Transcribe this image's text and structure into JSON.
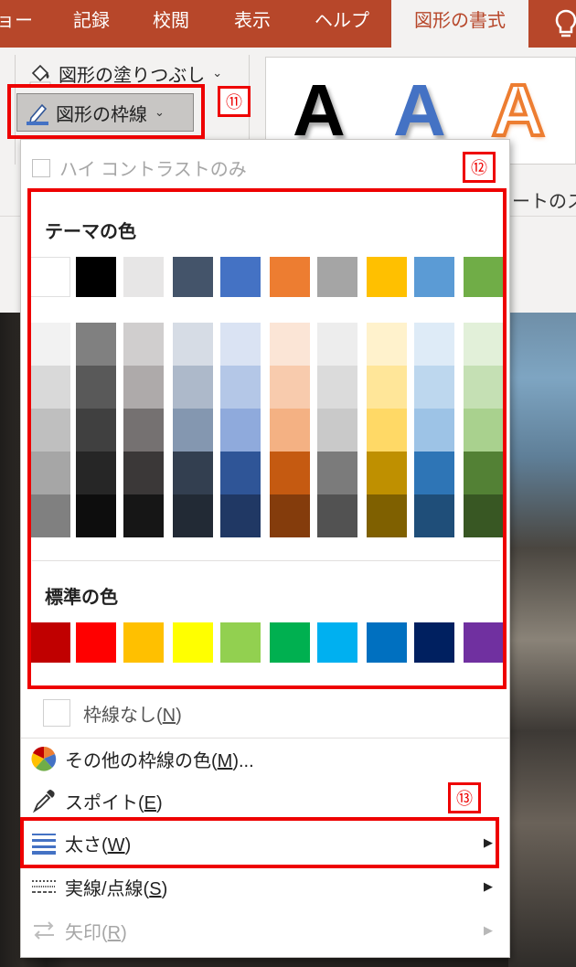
{
  "tabs": [
    {
      "label": "ョー"
    },
    {
      "label": "記録"
    },
    {
      "label": "校閲"
    },
    {
      "label": "表示"
    },
    {
      "label": "ヘルプ"
    },
    {
      "label": "図形の書式"
    }
  ],
  "ribbon": {
    "shape_fill_label": "図形の塗りつぶし",
    "shape_outline_label": "図形の枠線",
    "wordart_letter": "A",
    "gallery_label": "ートのス"
  },
  "annotations": {
    "badge_11": "⑪",
    "badge_12": "⑫",
    "badge_13": "⑬"
  },
  "menu": {
    "high_contrast_label": "ハイ コントラストのみ",
    "theme_colors_title": "テーマの色",
    "standard_colors_title": "標準の色",
    "no_outline": {
      "label": "枠線なし(",
      "key": "N",
      "suffix": ")"
    },
    "more_colors": {
      "label": "その他の枠線の色(",
      "key": "M",
      "suffix": ")..."
    },
    "eyedropper": {
      "label": "スポイト(",
      "key": "E",
      "suffix": ")"
    },
    "weight": {
      "label": "太さ(",
      "key": "W",
      "suffix": ")"
    },
    "dashes": {
      "label": "実線/点線(",
      "key": "S",
      "suffix": ")"
    },
    "arrows": {
      "label": "矢印(",
      "key": "R",
      "suffix": ")"
    }
  },
  "colors": {
    "accent": "#b7472a",
    "annotation_red": "#ee0000",
    "theme_top": [
      "#ffffff",
      "#000000",
      "#e7e6e6",
      "#44546a",
      "#4472c4",
      "#ed7d31",
      "#a5a5a5",
      "#ffc000",
      "#5b9bd5",
      "#70ad47"
    ],
    "theme_shades": [
      [
        "#f2f2f2",
        "#d9d9d9",
        "#bfbfbf",
        "#a6a6a6",
        "#808080"
      ],
      [
        "#808080",
        "#595959",
        "#404040",
        "#262626",
        "#0d0d0d"
      ],
      [
        "#d0cece",
        "#aeaaaa",
        "#757171",
        "#3b3838",
        "#161616"
      ],
      [
        "#d6dce5",
        "#adb9ca",
        "#8497b0",
        "#333f50",
        "#222a35"
      ],
      [
        "#dae3f3",
        "#b4c7e7",
        "#8faadc",
        "#2f5597",
        "#203864"
      ],
      [
        "#fbe5d6",
        "#f8cbad",
        "#f4b183",
        "#c55a11",
        "#843c0c"
      ],
      [
        "#ededed",
        "#dbdbdb",
        "#c9c9c9",
        "#7b7b7b",
        "#525252"
      ],
      [
        "#fff2cc",
        "#ffe699",
        "#ffd966",
        "#bf9000",
        "#7f6000"
      ],
      [
        "#deebf7",
        "#bdd7ee",
        "#9dc3e6",
        "#2e75b6",
        "#1f4e79"
      ],
      [
        "#e2f0d9",
        "#c5e0b4",
        "#a9d18e",
        "#538135",
        "#385723"
      ]
    ],
    "standard": [
      "#c00000",
      "#ff0000",
      "#ffc000",
      "#ffff00",
      "#92d050",
      "#00b050",
      "#00b0f0",
      "#0070c0",
      "#002060",
      "#7030a0"
    ]
  },
  "icons": {
    "bulb": "lightbulb-icon",
    "fill": "paint-bucket-icon",
    "outline": "pencil-outline-icon",
    "more_colors": "color-wheel-icon",
    "eyedropper": "eyedropper-icon",
    "weight": "line-weight-icon",
    "dashes": "dash-style-icon",
    "arrows": "arrows-icon"
  }
}
